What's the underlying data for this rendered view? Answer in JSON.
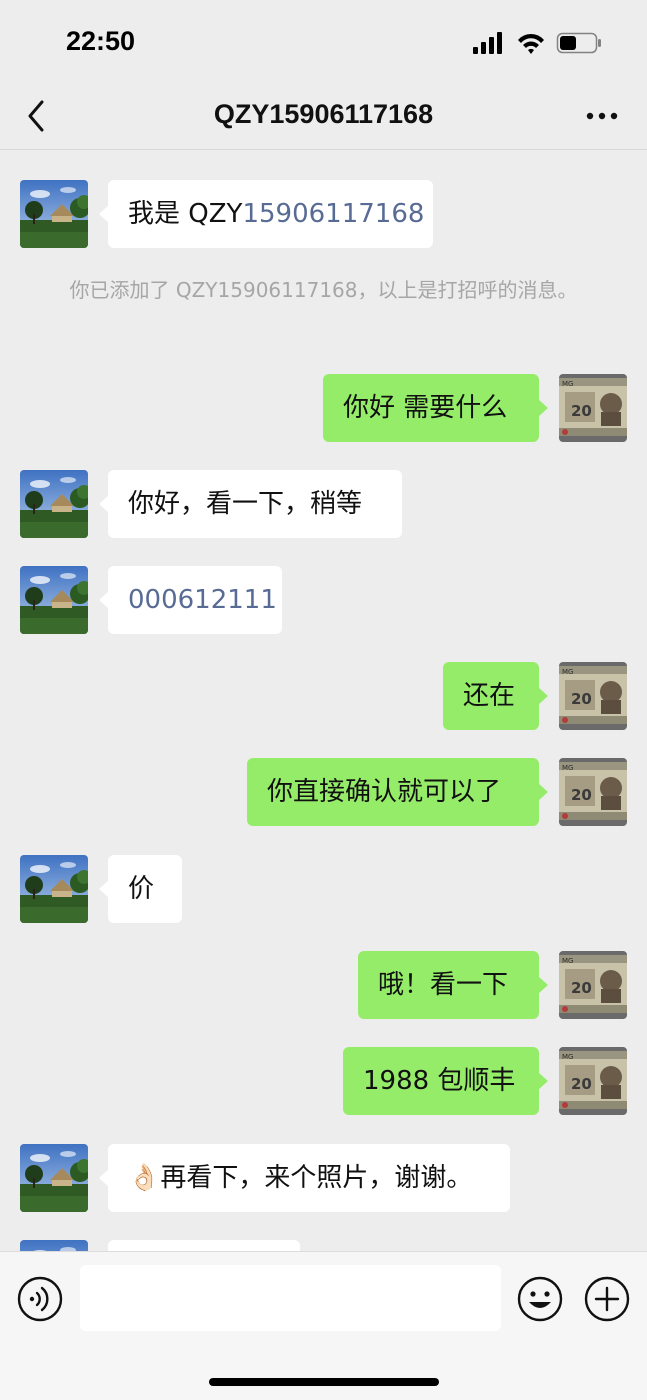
{
  "status_bar": {
    "time": "22:50"
  },
  "nav": {
    "title": "QZY15906117168"
  },
  "messages": {
    "m0_prefix": "我是 QZY",
    "m0_link": "15906117168",
    "system": "你已添加了 QZY15906117168，以上是打招呼的消息。",
    "m1": "你好 需要什么",
    "m2": "你好，看一下，稍等",
    "m3": "000612111",
    "m4": "还在",
    "m5": "你直接确认就可以了",
    "m6": "价",
    "m7": "哦！看一下",
    "m8": "1988 包顺丰",
    "m9_emoji": "👌🏻",
    "m9": "再看下，来个照片，谢谢。"
  },
  "input": {
    "placeholder": ""
  },
  "colors": {
    "background": "#ededed",
    "sent_bubble": "#95ec69",
    "received_bubble": "#ffffff",
    "link": "#576b95",
    "system_text": "#a6a6a6"
  },
  "icons": {
    "back": "chevron-left-icon",
    "more": "ellipsis-icon",
    "voice": "voice-icon",
    "emoji": "emoji-icon",
    "plus": "plus-icon"
  }
}
